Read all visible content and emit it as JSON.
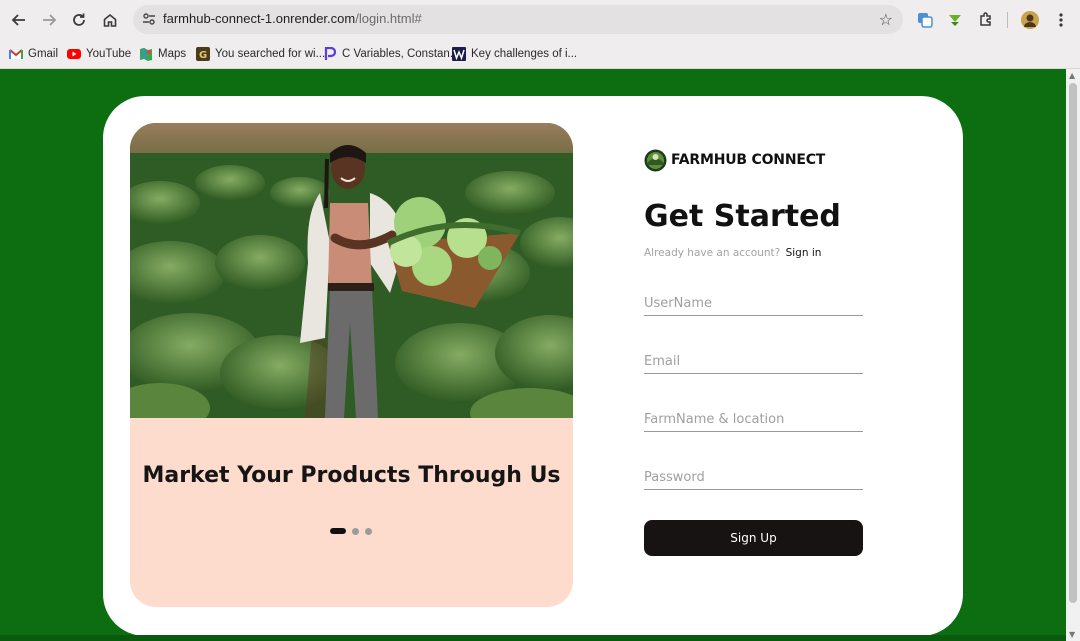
{
  "browser": {
    "url_host": "farmhub-connect-1.onrender.com",
    "url_path": "/login.html#",
    "bookmarks": [
      {
        "label": "Gmail",
        "icon": "gmail-icon"
      },
      {
        "label": "YouTube",
        "icon": "youtube-icon"
      },
      {
        "label": "Maps",
        "icon": "maps-icon"
      },
      {
        "label": "You searched for wi...",
        "icon": "g-site-icon"
      },
      {
        "label": "C Variables, Constan...",
        "icon": "p-site-icon"
      },
      {
        "label": "Key challenges of i...",
        "icon": "w-site-icon"
      }
    ]
  },
  "carousel": {
    "title": "Market Your Products Through Us",
    "slide_count": 3,
    "active_slide": 1
  },
  "brand": {
    "name": "FARMHUB CONNECT"
  },
  "form": {
    "heading": "Get Started",
    "have_account": "Already have an account?",
    "signin_link": "Sign in",
    "username_placeholder": "UserName",
    "email_placeholder": "Email",
    "farm_placeholder": "FarmName & location",
    "password_placeholder": "Password",
    "submit_label": "Sign Up"
  },
  "colors": {
    "page_bg": "#0c6e10",
    "carousel_bg": "#fddccd",
    "button_bg": "#171312"
  }
}
